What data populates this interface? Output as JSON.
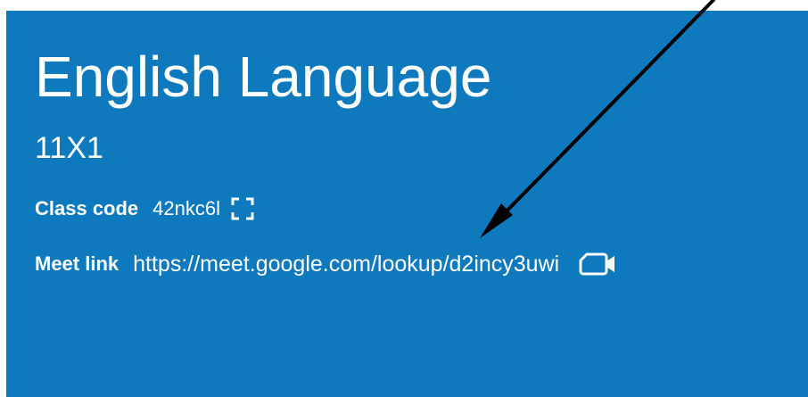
{
  "class_card": {
    "title": "English Language",
    "section": "11X1",
    "class_code_label": "Class code",
    "class_code_value": "42nkc6l",
    "meet_link_label": "Meet link",
    "meet_link_value": "https://meet.google.com/lookup/d2incy3uwi"
  },
  "icons": {
    "display_code": "fullscreen-icon",
    "join_meet": "video-camera-icon"
  },
  "colors": {
    "banner_background": "#0e79bd",
    "text": "#ffffff",
    "annotation_arrow": "#000000"
  }
}
